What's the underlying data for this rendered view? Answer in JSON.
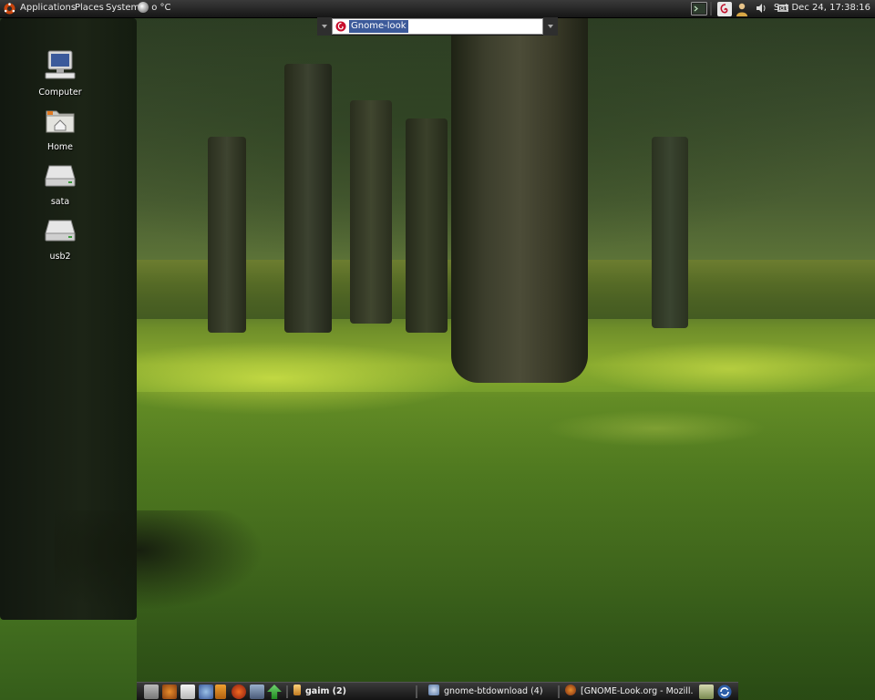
{
  "top_panel": {
    "menus": [
      "Applications",
      "Places",
      "System"
    ],
    "weather_text": "o °C",
    "clock": "Sat Dec 24, 17:38:16"
  },
  "search_bar": {
    "value": "Gnome-look"
  },
  "desktop_icons": [
    {
      "label": "Computer",
      "icon": "computer-icon"
    },
    {
      "label": "Home",
      "icon": "home-folder-icon"
    },
    {
      "label": "sata",
      "icon": "drive-icon"
    },
    {
      "label": "usb2",
      "icon": "drive-icon"
    }
  ],
  "taskbar": {
    "tasks": [
      {
        "label": "gaim (2)",
        "icon": "gaim-icon"
      },
      {
        "label": "gnome-btdownload (4)",
        "icon": "download-icon"
      },
      {
        "label": "[GNOME-Look.org - Mozill...",
        "icon": "firefox-icon"
      }
    ]
  },
  "colors": {
    "panel": "#1f1f1f",
    "selection": "#3c5a9a"
  }
}
